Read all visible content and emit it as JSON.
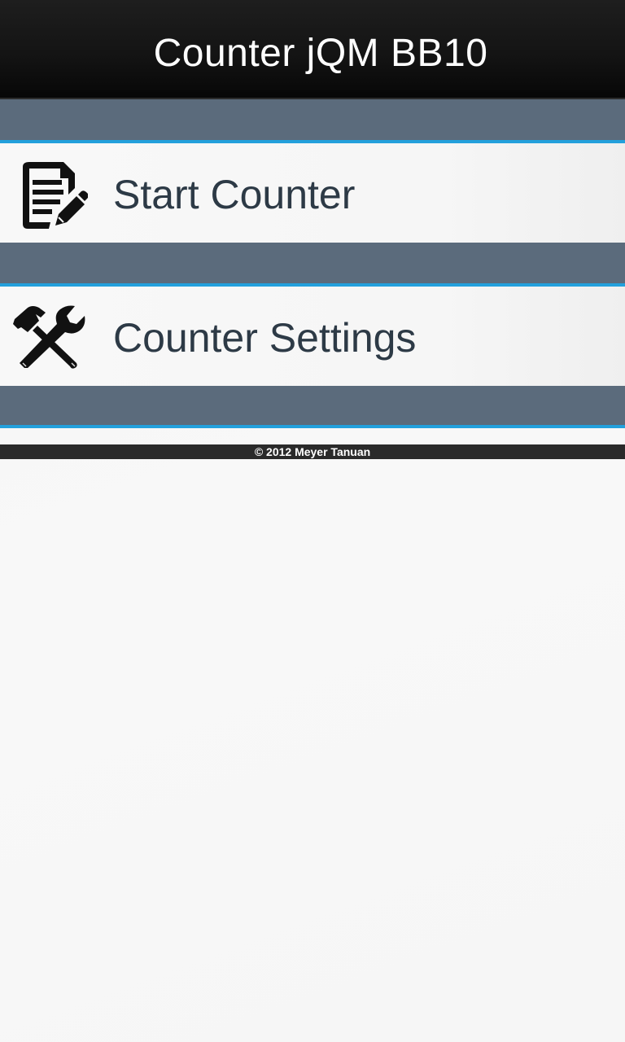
{
  "header": {
    "title": "Counter jQM BB10"
  },
  "menu": {
    "items": [
      {
        "label": "Start Counter",
        "icon": "document-edit-icon"
      },
      {
        "label": "Counter Settings",
        "icon": "tools-icon"
      }
    ]
  },
  "footer": {
    "copyright": "© 2012 Meyer Tanuan"
  },
  "colors": {
    "header_bg": "#141414",
    "divider_bg": "#5b6b7c",
    "accent": "#23a0dc",
    "item_bg": "#f7f7f7",
    "item_text": "#2d3a46",
    "footer_bg": "#2a2a2a"
  }
}
